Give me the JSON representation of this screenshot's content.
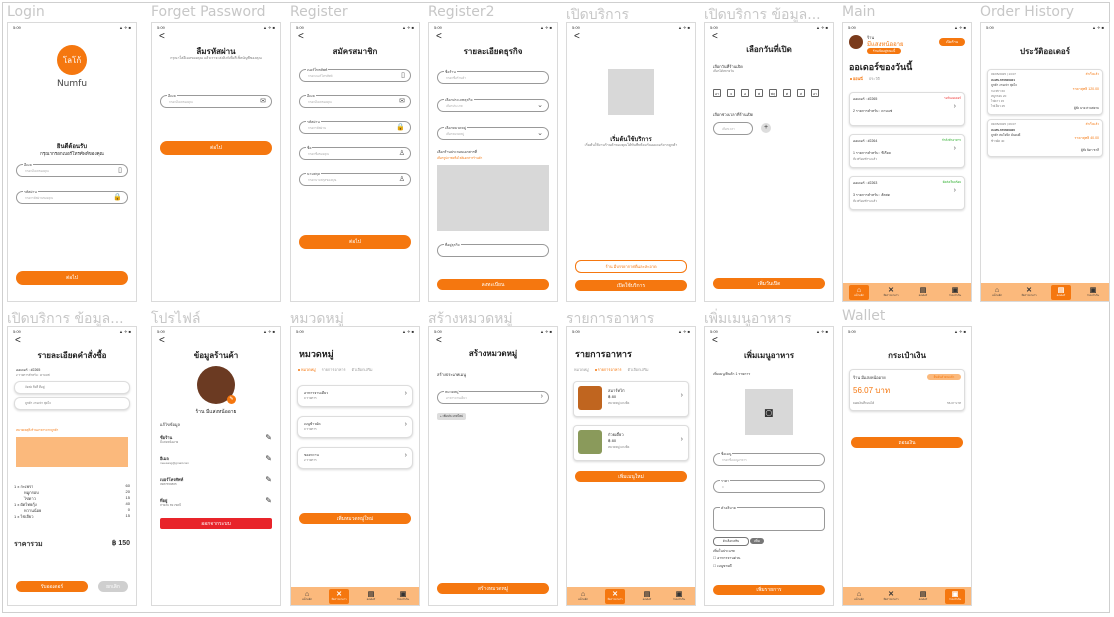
{
  "accent_color": "#f5770f",
  "status": {
    "time": "5:09",
    "signal": "▲ ✈ ■"
  },
  "screens": {
    "login": {
      "caption": "Login",
      "logo_text": "โลโก้",
      "brand": "Numfu",
      "welcome": "ยินดีต้อนรับ",
      "instruction": "กรุณากรอกเบอร์โทรศัพท์ของคุณ",
      "field1": "อีเมล",
      "field1_ph": "กรอกอีเมลของคุณ",
      "field2": "รหัสผ่าน",
      "field2_ph": "กรอกรหัสผ่านของคุณ",
      "button": "ต่อไป"
    },
    "forget": {
      "caption": "Forget Password",
      "heading": "ลืมรหัสผ่าน",
      "sub": "กรุณาใส่อีเมลของคุณ แล้วเราจะส่งลิงก์เพื่อรีเซ็ตบัญชีของคุณ",
      "field": "อีเมล",
      "field_ph": "กรอกอีเมลของคุณ",
      "button": "ต่อไป"
    },
    "register": {
      "caption": "Register",
      "heading": "สมัครสมาชิก",
      "fields": [
        {
          "label": "เบอร์โทรศัพท์",
          "ph": "กรอกเบอร์โทรศัพท์",
          "icon": "▯"
        },
        {
          "label": "อีเมล",
          "ph": "กรอกอีเมลของคุณ",
          "icon": "✉"
        },
        {
          "label": "รหัสผ่าน",
          "ph": "กรอกรหัสผ่าน",
          "icon": "🔒"
        },
        {
          "label": "ชื่อ",
          "ph": "กรอกชื่อของคุณ",
          "icon": "♙"
        },
        {
          "label": "นามสกุล",
          "ph": "กรอกนามสกุลของคุณ",
          "icon": "♙"
        }
      ],
      "button": "ต่อไป"
    },
    "register2": {
      "caption": "Register2",
      "heading": "รายละเอียดธุรกิจ",
      "fields": [
        {
          "label": "ชื่อร้าน",
          "ph": "กรอกชื่อร้านค้า"
        },
        {
          "label": "เลือกประเภทธุรกิจ",
          "ph": "เลือกประเภท"
        },
        {
          "label": "เลือกหมวดหมู่",
          "ph": "เลือกหมวดหมู่"
        }
      ],
      "upload_label": "เลือกร้านประกอบเอกสารที่",
      "upload_hint": "เลือกรูปภาพหรือไฟล์เอกสารร้านค้า",
      "address_label": "ที่อยู่ธุรกิจ",
      "button": "ลงทะเบียน"
    },
    "open_service": {
      "caption": "เปิดบริการ",
      "title": "เริ่มต้นใช้บริการ",
      "sub": "เริ่มต้นใช้งานร้านค้าของคุณได้ทันทีพร้อมรับออเดอร์จากลูกค้า",
      "outline_button": "ร้าน มีบรรยากาศดีและสะอาด",
      "button": "เปิดใช้บริการ"
    },
    "open_detail": {
      "caption": "เปิดบริการ ข้อมูล...",
      "heading": "เลือกวันที่เปิด",
      "days_label": "เลือกวันที่ร้านเปิด",
      "days_hint": "เลือกได้หลายวัน",
      "days": [
        "อา",
        "จ",
        "อ",
        "พ",
        "พฤ",
        "ศ",
        "ส",
        "อา"
      ],
      "time_label": "เลือกช่วงเวลาที่ร้านเปิด",
      "time_ph": "เลือกเวลา",
      "button": "เพิ่มวันเปิด"
    },
    "main": {
      "caption": "Main",
      "shop_label": "ร้าน",
      "shop_name": "มีแสงหน้ออาย",
      "badge": "เปิดร้าน",
      "subbadge": "ร้านเปิดอยู่ขณะนี้",
      "heading": "ออเดอร์ของวันนี้",
      "tabs": [
        "ออนนี่",
        "ประวัติ"
      ],
      "orders": [
        {
          "id": "ออเดอร์ : #2265",
          "status": "รอรับออเดอร์",
          "item": "2 รายการสำหรับ : ดาบแซ่"
        },
        {
          "id": "ออเดอร์ : #2264",
          "status": "กำลังทำอาหาร",
          "item": "1 รายการสำหรับ : ซีเรียล",
          "note": "สั่ง พร้อมชำระแล้ว"
        },
        {
          "id": "ออเดอร์ : #2263",
          "status": "จัดส่งเรียบร้อย",
          "item": "3 รายการสำหรับ : ส้ตสด",
          "note": "สั่ง พร้อมชำระแล้ว"
        }
      ]
    },
    "history": {
      "caption": "Order History",
      "heading": "ประวัติออเดอร์",
      "orders": [
        {
          "date": "03/05/2025 | 13:07",
          "status": "สำเร็จแล้ว",
          "id": "#LMS-670600921",
          "name": "ลูกค้า งามเท่า สุดใจ",
          "price": "ราคาสุทธิ 120.00",
          "rows": [
            "กะเพรา 60",
            "หมูกรอบ 20",
            "ไข่ดาว 15",
            "ไข่เจียว 25"
          ],
          "customer": "ผู้สั่ง นาย สวนสยาม"
        },
        {
          "date": "03/05/2025 | 09:07",
          "status": "สำเร็จแล้ว",
          "id": "#LMS-670600920",
          "name": "ลูกค้า สมใจนึก มั่นคงดี",
          "price": "ราคาสุทธิ 40.00",
          "rows": [
            "ข้าวผัด 40"
          ],
          "customer": "ผู้สั่ง นิดา ชาลี"
        }
      ]
    },
    "order_detail": {
      "caption": "เปิดบริการ ข้อมูล...",
      "heading": "รายละเอียดคำสั่งซื้อ",
      "order_no": "ออเดอร์ : #2265",
      "order_sub": "2 รายการสำหรับ : ดาบแซ่",
      "opts": [
        "จัดส่ง ถึงที่ ที่อยู่",
        "ลูกค้า งามเท่า สุดใจ"
      ],
      "note_label": "หมายเหตุถึงร้านอาหารจากลูกค้า",
      "lines": [
        {
          "name": "1 x กะเพรา",
          "price": "60"
        },
        {
          "name": "หมูกรอบ",
          "price": "20"
        },
        {
          "name": "ไข่ดาว",
          "price": "15"
        },
        {
          "name": "1 x ผัดไทยกุ้ง",
          "price": "40"
        },
        {
          "name": "หวานน้อย",
          "price": "0"
        },
        {
          "name": "1 x ไข่เจียว",
          "price": "15"
        }
      ],
      "total_label": "ราคารวม",
      "total": "฿ 150",
      "confirm": "รับออเดอร์",
      "cancel": "ยกเลิก"
    },
    "profile": {
      "caption": "โปรไฟล์",
      "heading": "ข้อมูลร้านค้า",
      "shop_name": "ร้าน มีแสงหน้ออาย",
      "section": "แก้ไขข้อมูล",
      "fields": [
        {
          "label": "ชื่อร้าน",
          "value": "มีแสงหน้ออาย"
        },
        {
          "label": "อีเมล",
          "value": "meesang@gmail.com"
        },
        {
          "label": "เบอร์โทรศัพท์",
          "value": "0987659865"
        },
        {
          "label": "ที่อยู่",
          "value": "สายลม 89 เขตบี"
        }
      ],
      "button": "ออกจากระบบ"
    },
    "category": {
      "caption": "หมวดหมู่",
      "heading": "หมวดหมู่",
      "tabs": [
        "หมวดหมู่",
        "รายการอาหาร",
        "ตัวเลือกเสริม"
      ],
      "cats": [
        {
          "name": "อาหารจานเดียว",
          "count": "0 รายการ"
        },
        {
          "name": "เมนูข้าวผัด",
          "count": "0 รายการ"
        },
        {
          "name": "ของหวาน",
          "count": "2 รายการ"
        }
      ],
      "button": "เพิ่มหมวดหมู่ใหม่"
    },
    "create_category": {
      "caption": "สร้างหมวดหมู่",
      "heading": "สร้างหมวดหมู่",
      "label": "สร้างประเภทเมนู",
      "field": "หมวดหมู่",
      "field_ph": "อาหารจานเดียว",
      "chip": "+ เพิ่มประเภทใหม่",
      "button": "สร้างหมวดหมู่"
    },
    "menu": {
      "caption": "รายการอาหาร",
      "heading": "รายการอาหาร",
      "tabs": [
        "หมวดหมู่",
        "รายการอาหาร",
        "ตัวเลือกเสริม"
      ],
      "items": [
        {
          "name": "สมาร์ทไก่",
          "price": "฿ 80",
          "cat": "หมวดหมู่ แกงจืด"
        },
        {
          "name": "ก๋วยเตี๋ยว",
          "price": "฿ 80",
          "cat": "หมวดหมู่ แกงจืด"
        }
      ],
      "button": "เพิ่มเมนูใหม่"
    },
    "add_menu": {
      "caption": "เพิ่มเมนูอาหาร",
      "heading": "เพิ่มเมนูอาหาร",
      "sub": "เพิ่มเมนู/สินค้า 1 รายการ",
      "f1": "ชื่อเมนู",
      "f1_ph": "กรอกชื่อเมนูอาหาร",
      "f2": "ราคา",
      "f2_ph": "0",
      "f3": "คำอธิบาย",
      "opt_chip": "ตัวเลือกเสริม",
      "add_chip": "เพิ่ม",
      "check_title": "เพิ่มในประเภท",
      "checks": [
        "อาหารจานด่วน",
        "เมนูขายดี"
      ],
      "button": "เพิ่มรายการ"
    },
    "wallet": {
      "caption": "Wallet",
      "heading": "กระเป๋าเงิน",
      "shop": "ร้าน มีแสงหน้ออาย",
      "badge": "ยืนยันตัวตนแล้ว",
      "amount": "56.07 บาท",
      "balance_label": "ยอดเงินที่ถอนได้",
      "balance": "56.07 บาท",
      "button": "ถอนเงิน"
    }
  },
  "nav": {
    "home": "หน้าหลัก",
    "food": "จัดการอาหาร",
    "orders": "ออเดอร์",
    "wallet": "กระเป๋าเงิน"
  }
}
